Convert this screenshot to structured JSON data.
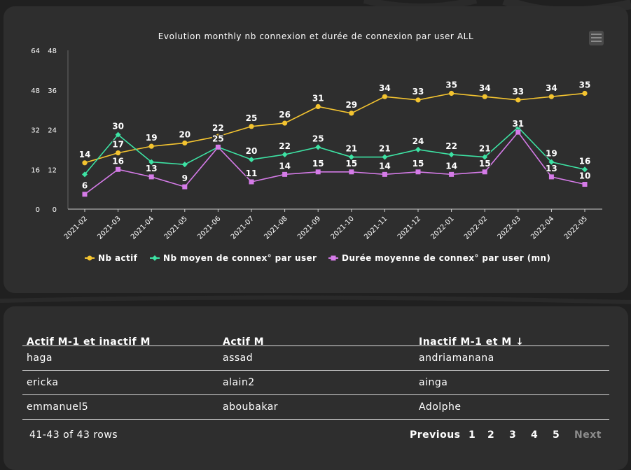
{
  "chart": {
    "title": "Evolution monthly nb connexion et durée de connexion par user ALL",
    "chart_data": {
      "type": "line",
      "categories": [
        "2021-02",
        "2021-03",
        "2021-04",
        "2021-05",
        "2021-06",
        "2021-07",
        "2021-08",
        "2021-09",
        "2021-10",
        "2021-11",
        "2021-12",
        "2022-01",
        "2022-02",
        "2022-03",
        "2022-04",
        "2022-05"
      ],
      "series": [
        {
          "name": "Nb actif",
          "color": "#f4c430",
          "marker": "circle",
          "axis": "left",
          "values": [
            14,
            17,
            19,
            20,
            22,
            25,
            26,
            31,
            29,
            34,
            33,
            35,
            34,
            33,
            34,
            35
          ],
          "labels": [
            "14",
            "17",
            "19",
            "20",
            "22",
            "25",
            "26",
            "31",
            "29",
            "34",
            "33",
            "35",
            "34",
            "33",
            "34",
            "35"
          ]
        },
        {
          "name": "Nb moyen de connex° par user",
          "color": "#3de3a4",
          "marker": "diamond",
          "axis": "right",
          "values": [
            14,
            30,
            19,
            18,
            25,
            20,
            22,
            25,
            21,
            21,
            24,
            22,
            21,
            33,
            19,
            16
          ],
          "labels": [
            "",
            "30",
            "",
            "",
            "25",
            "20",
            "22",
            "25",
            "21",
            "21",
            "24",
            "22",
            "21",
            "",
            "19",
            "16"
          ]
        },
        {
          "name": "Durée moyenne de connex° par user (mn)",
          "color": "#d57be8",
          "marker": "square",
          "axis": "right",
          "values": [
            6,
            16,
            13,
            9,
            25,
            11,
            14,
            15,
            15,
            14,
            15,
            14,
            15,
            31,
            13,
            10
          ],
          "labels": [
            "6",
            "16",
            "13",
            "9",
            "",
            "11",
            "14",
            "15",
            "15",
            "14",
            "15",
            "14",
            "15",
            "31",
            "13",
            "10"
          ]
        }
      ],
      "y_left": {
        "ticks": [
          "0",
          "12",
          "24",
          "36",
          "48"
        ],
        "ylim": [
          0,
          48
        ]
      },
      "y_right": {
        "ticks": [
          "0",
          "16",
          "32",
          "48",
          "64"
        ],
        "ylim": [
          0,
          64
        ]
      },
      "legend_position": "bottom",
      "grid": false
    }
  },
  "table": {
    "headers": [
      "Actif M-1 et inactif M",
      "Actif M",
      "Inactif M-1 et M ↓"
    ],
    "rows": [
      [
        "haga",
        "assad",
        "andriamanana"
      ],
      [
        "ericka",
        "alain2",
        "ainga"
      ],
      [
        "emmanuel5",
        "aboubakar",
        "Adolphe"
      ]
    ],
    "info": "41-43 of 43 rows",
    "pagination": {
      "previous": "Previous",
      "pages": [
        "1",
        "2",
        "3",
        "4",
        "5"
      ],
      "current": "5",
      "next": "Next"
    }
  }
}
